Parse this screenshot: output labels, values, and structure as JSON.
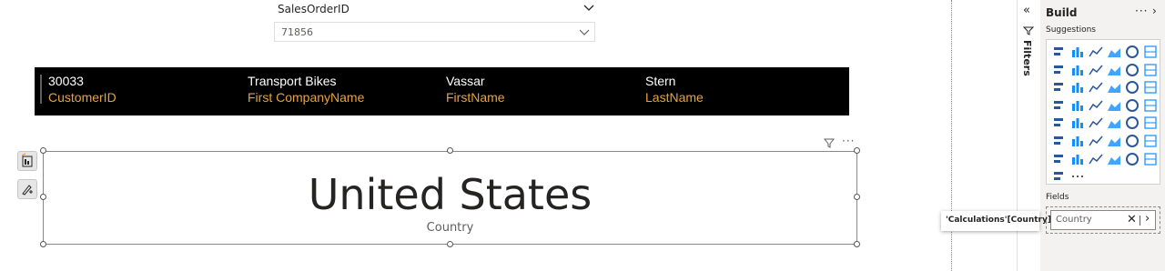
{
  "slicer": {
    "title": "SalesOrderID",
    "selected_value": "71856"
  },
  "multi_row_card": {
    "fields": [
      {
        "value": "30033",
        "label": "CustomerID"
      },
      {
        "value": "Transport Bikes",
        "label": "First CompanyName"
      },
      {
        "value": "Vassar",
        "label": "FirstName"
      },
      {
        "value": "Stern",
        "label": "LastName"
      }
    ],
    "colors": {
      "background": "#000000",
      "value_text": "#ffffff",
      "label_text": "#e8a33b"
    }
  },
  "card": {
    "value": "United States",
    "label": "Country"
  },
  "filters_pane": {
    "label": "Filters",
    "icons": [
      "collapse-chevrons-icon",
      "filter-icon"
    ]
  },
  "build_pane": {
    "title": "Build",
    "more_label": "···",
    "suggestions_label": "Suggestions",
    "visual_icons": [
      "stacked-bar-chart-icon",
      "stacked-column-chart-icon",
      "clustered-bar-chart-icon",
      "clustered-column-chart-icon",
      "100pct-stacked-bar-chart-icon",
      "100pct-stacked-column-chart-icon",
      "line-chart-icon",
      "area-chart-icon",
      "stacked-area-chart-icon",
      "100pct-stacked-area-chart-icon",
      "line-and-column-chart-icon",
      "line-and-stacked-column-chart-icon",
      "ribbon-chart-icon",
      "waterfall-chart-icon",
      "funnel-chart-icon",
      "scatter-chart-icon",
      "pie-chart-icon",
      "donut-chart-icon",
      "treemap-icon",
      "map-icon",
      "filled-map-icon",
      "shape-map-icon",
      "azure-map-icon",
      "gauge-icon",
      "card-icon",
      "multi-row-card-icon",
      "kpi-icon",
      "slicer-icon",
      "table-icon",
      "matrix-icon",
      "r-visual-icon",
      "python-visual-icon",
      "key-influencers-icon",
      "decomposition-tree-icon",
      "qna-icon",
      "paginated-report-icon",
      "metrics-icon",
      "smart-narrative-icon",
      "power-apps-icon",
      "power-automate-icon",
      "arcgis-map-icon",
      "get-more-visuals-icon",
      "custom-visual-icon",
      "more-visuals-icon"
    ],
    "fields_label": "Fields",
    "field_chip": "Country",
    "tooltip": "'Calculations'[Country]"
  }
}
